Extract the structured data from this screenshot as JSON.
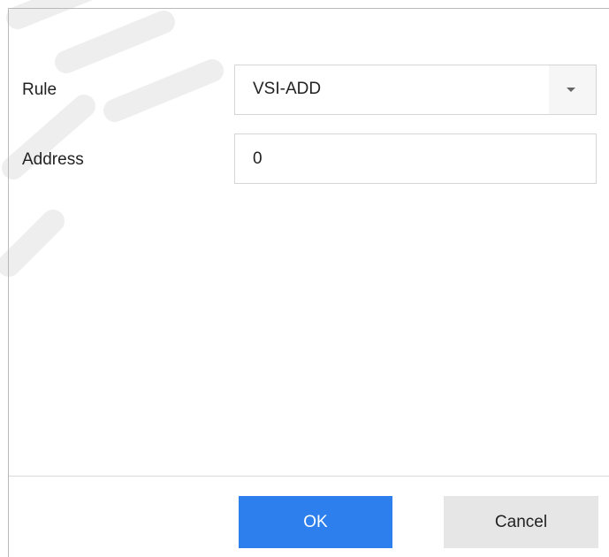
{
  "form": {
    "rule": {
      "label": "Rule",
      "value": "VSI-ADD"
    },
    "address": {
      "label": "Address",
      "value": "0"
    }
  },
  "footer": {
    "ok_label": "OK",
    "cancel_label": "Cancel"
  },
  "colors": {
    "primary_button": "#2d7fed",
    "secondary_button": "#e6e6e6",
    "border": "#d5d5d5"
  },
  "icons": {
    "dropdown": "chevron-down-icon"
  }
}
